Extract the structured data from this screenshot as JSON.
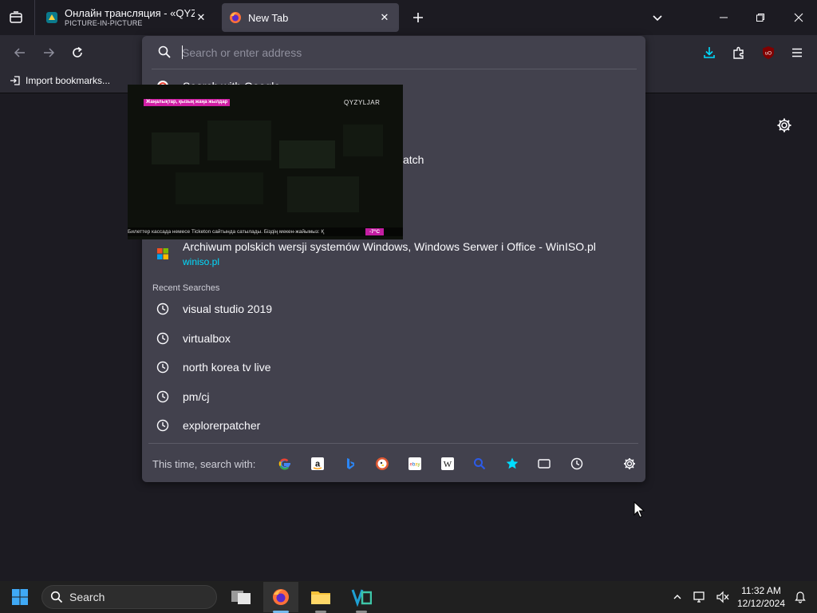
{
  "tabs": [
    {
      "title": "Онлайн трансляция - «QYZYLJ",
      "subtitle": "PICTURE-IN-PICTURE",
      "active": false
    },
    {
      "title": "New Tab",
      "subtitle": "",
      "active": true
    }
  ],
  "bookmarks_bar": {
    "import_label": "Import bookmarks..."
  },
  "urlbar": {
    "placeholder": "Search or enter address",
    "value": "",
    "partial_rows": {
      "first": "Search with Google",
      "watch_suffix": "atch"
    },
    "result": {
      "title": "Archiwum polskich wersji systemów Windows, Windows Serwer i Office - WinISO.pl",
      "url": "winiso.pl"
    },
    "recent_header": "Recent Searches",
    "recent_searches": [
      "visual studio 2019",
      "virtualbox",
      "north korea tv live",
      "pm/cj",
      "explorerpatcher"
    ],
    "footer_label": "This time, search with:",
    "engines": [
      "google-icon",
      "amazon-icon",
      "bing-icon",
      "duckduckgo-icon",
      "ebay-icon",
      "wikipedia-icon",
      "search-tabs-icon",
      "bookmarks-star-icon",
      "tabs-icon",
      "history-icon"
    ]
  },
  "pip": {
    "badge": "Жаңалықтар, қызық жаңа жылдар",
    "logo": "QYZYLJAR",
    "ticker": "Билеттер кассада немесе Ticketon сайтында сатылады. Біздің мекен-жайымыз: Қ",
    "temperature": "-7°C"
  },
  "taskbar": {
    "search_label": "Search",
    "time": "11:32 AM",
    "date": "12/12/2024"
  },
  "colors": {
    "accent": "#00ddff",
    "popup_bg": "#42414d",
    "toolbar_bg": "#2b2a33",
    "page_bg": "#1c1b22",
    "download_blue": "#00ddff"
  }
}
